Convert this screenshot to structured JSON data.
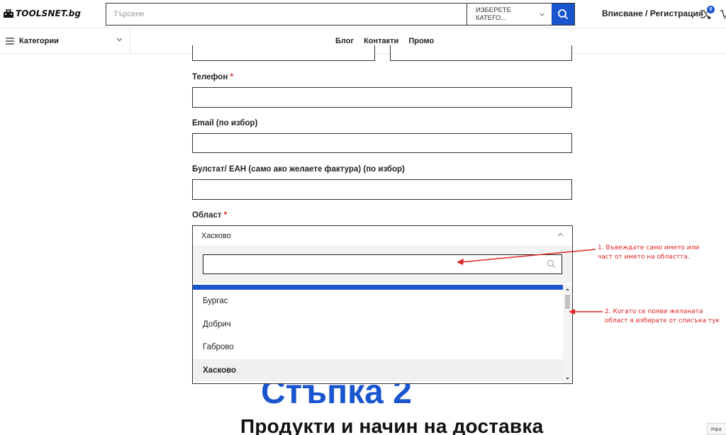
{
  "header": {
    "logo_text": "TOOLSNET.bg",
    "search_placeholder": "Търсене",
    "category_select": "ИЗБЕРЕТЕ КАТЕГО...",
    "login_label": "Вписване / Регистрация",
    "compare_count": "0"
  },
  "navbar": {
    "categories_label": "Категории",
    "links": [
      "Блог",
      "Контакти",
      "Промо"
    ]
  },
  "form": {
    "phone_label": "Телефон",
    "email_label": "Email (по избор)",
    "bulstat_label": "Булстат/ ЕАН (само ако желаете фактура) (по избор)",
    "region_label": "Област",
    "required_mark": "*",
    "region_value": "Хасково",
    "region_options": [
      "Бургас",
      "Добрич",
      "Габрово",
      "Хасково"
    ],
    "selected_option": "Хасково"
  },
  "annotations": {
    "note1_line1": "1. Въвеждате само името или",
    "note1_line2": "част от името на областта.",
    "note2_line1": "2. Когато се появи желаната",
    "note2_line2": "област я избирате от списъка тук"
  },
  "page": {
    "behind_text": "Стъпка 2",
    "section_heading": "Продукти и начин на доставка"
  },
  "recaptcha_label": "Упра",
  "colors": {
    "accent_blue": "#1a55d0",
    "annotation_red": "#e02424",
    "required_red": "#e02424"
  }
}
